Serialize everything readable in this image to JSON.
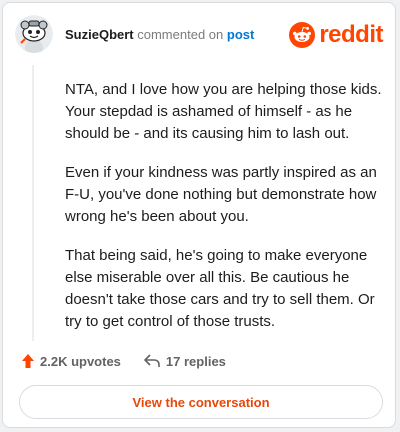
{
  "header": {
    "username": "SuzieQbert",
    "commented_on": "commented on",
    "post_link": "post",
    "brand": "reddit"
  },
  "comment": {
    "paragraphs": [
      "NTA, and I love how you are helping those kids. Your stepdad is ashamed of himself - as he should be - and its causing him to lash out.",
      "Even if your kindness was partly inspired as an F-U, you've done nothing but demonstrate how wrong he's been about you.",
      "That being said, he's going to make everyone else miserable over all this. Be cautious he doesn't take those cars and try to sell them. Or try to get control of those trusts."
    ]
  },
  "actions": {
    "upvotes": "2.2K upvotes",
    "replies": "17 replies"
  },
  "cta": {
    "label": "View the conversation"
  },
  "colors": {
    "brand": "#ff4500",
    "link": "#0079d3",
    "cta_text": "#e8470c",
    "upvote_arrow": "#ff4500"
  },
  "icons": [
    "snoo-avatar-icon",
    "reddit-logo-icon",
    "upvote-arrow-icon",
    "reply-icon"
  ]
}
